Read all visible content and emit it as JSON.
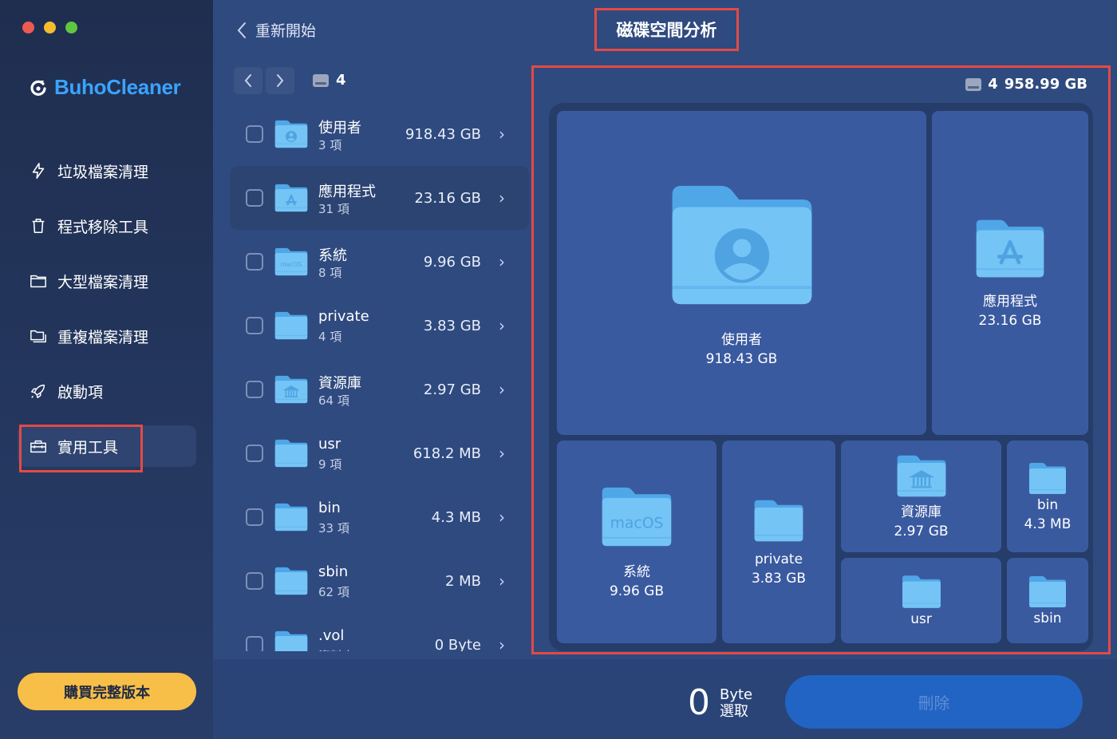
{
  "app": {
    "name": "BuhoCleaner"
  },
  "sidebar": {
    "items": [
      {
        "label": "垃圾檔案清理",
        "icon": "bolt-icon"
      },
      {
        "label": "程式移除工具",
        "icon": "trash-icon"
      },
      {
        "label": "大型檔案清理",
        "icon": "folder-icon"
      },
      {
        "label": "重複檔案清理",
        "icon": "folders-icon"
      },
      {
        "label": "啟動項",
        "icon": "rocket-icon"
      },
      {
        "label": "實用工具",
        "icon": "toolbox-icon",
        "active": true
      }
    ],
    "buy_label": "購買完整版本"
  },
  "header": {
    "back_label": "重新開始",
    "title": "磁碟空間分析"
  },
  "list": {
    "disk_label": "4",
    "rows": [
      {
        "name": "使用者",
        "count": "3 項",
        "size": "918.43 GB",
        "badge": "user"
      },
      {
        "name": "應用程式",
        "count": "31 項",
        "size": "23.16 GB",
        "badge": "app",
        "selected": true
      },
      {
        "name": "系統",
        "count": "8 項",
        "size": "9.96 GB",
        "badge": "macos"
      },
      {
        "name": "private",
        "count": "4 項",
        "size": "3.83 GB",
        "badge": ""
      },
      {
        "name": "資源庫",
        "count": "64 項",
        "size": "2.97 GB",
        "badge": "library"
      },
      {
        "name": "usr",
        "count": "9 項",
        "size": "618.2 MB",
        "badge": ""
      },
      {
        "name": "bin",
        "count": "33 項",
        "size": "4.3 MB",
        "badge": ""
      },
      {
        "name": "sbin",
        "count": "62 項",
        "size": "2 MB",
        "badge": ""
      },
      {
        "name": ".vol",
        "count": "資料夾",
        "size": "0 Byte",
        "badge": ""
      }
    ]
  },
  "treemap": {
    "disk_label": "4",
    "total": "958.99 GB",
    "tiles": [
      {
        "name": "使用者",
        "size": "918.43 GB"
      },
      {
        "name": "應用程式",
        "size": "23.16 GB"
      },
      {
        "name": "系統",
        "size": "9.96 GB",
        "badge_text": "macOS"
      },
      {
        "name": "private",
        "size": "3.83 GB"
      },
      {
        "name": "資源庫",
        "size": "2.97 GB"
      },
      {
        "name": "bin",
        "size": "4.3 MB"
      },
      {
        "name": "usr",
        "size": ""
      },
      {
        "name": "sbin",
        "size": ""
      }
    ]
  },
  "footer": {
    "selected_value": "0",
    "selected_unit": "Byte",
    "selected_label": "選取",
    "delete_label": "刪除"
  }
}
